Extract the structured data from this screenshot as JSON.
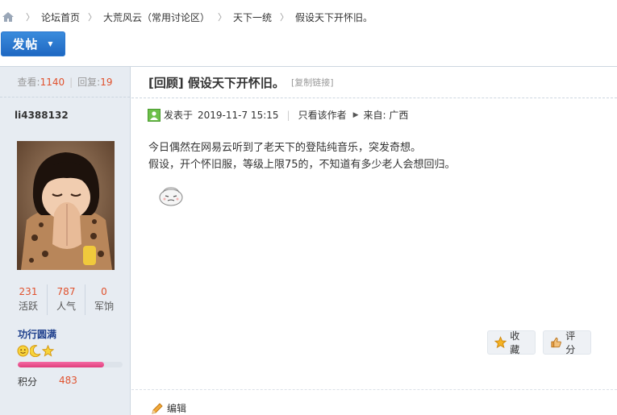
{
  "breadcrumb": {
    "home_icon": "home-icon",
    "items": [
      "论坛首页",
      "大荒风云（常用讨论区）",
      "天下一统",
      "假设天下开怀旧。"
    ]
  },
  "post_button": {
    "label": "发帖",
    "accent": "#2a77cf"
  },
  "stats": {
    "views_label": "查看:",
    "views": "1140",
    "replies_label": "回复:",
    "replies": "19"
  },
  "thread": {
    "title": "[回顾] 假设天下开怀旧。",
    "copy_link": "[复制链接]"
  },
  "author": {
    "username": "li4388132",
    "counts": [
      {
        "value": "231",
        "label": "活跃"
      },
      {
        "value": "787",
        "label": "人气"
      },
      {
        "value": "0",
        "label": "军饷"
      }
    ],
    "rank": "功行圆满",
    "rank_progress": 0.82,
    "points_label": "积分",
    "points": "483"
  },
  "meta": {
    "posted_label": "发表于",
    "posted_time": "2019-11-7 15:15",
    "author_only": "只看该作者",
    "from_label": "来自: 广西"
  },
  "content": {
    "lines": [
      "今日偶然在网易云听到了老天下的登陆纯音乐，突发奇想。",
      "假设，开个怀旧服，等级上限75的，不知道有多少老人会想回归。"
    ]
  },
  "actions": {
    "favorite": "收藏",
    "rate": "评分",
    "edit": "编辑"
  }
}
